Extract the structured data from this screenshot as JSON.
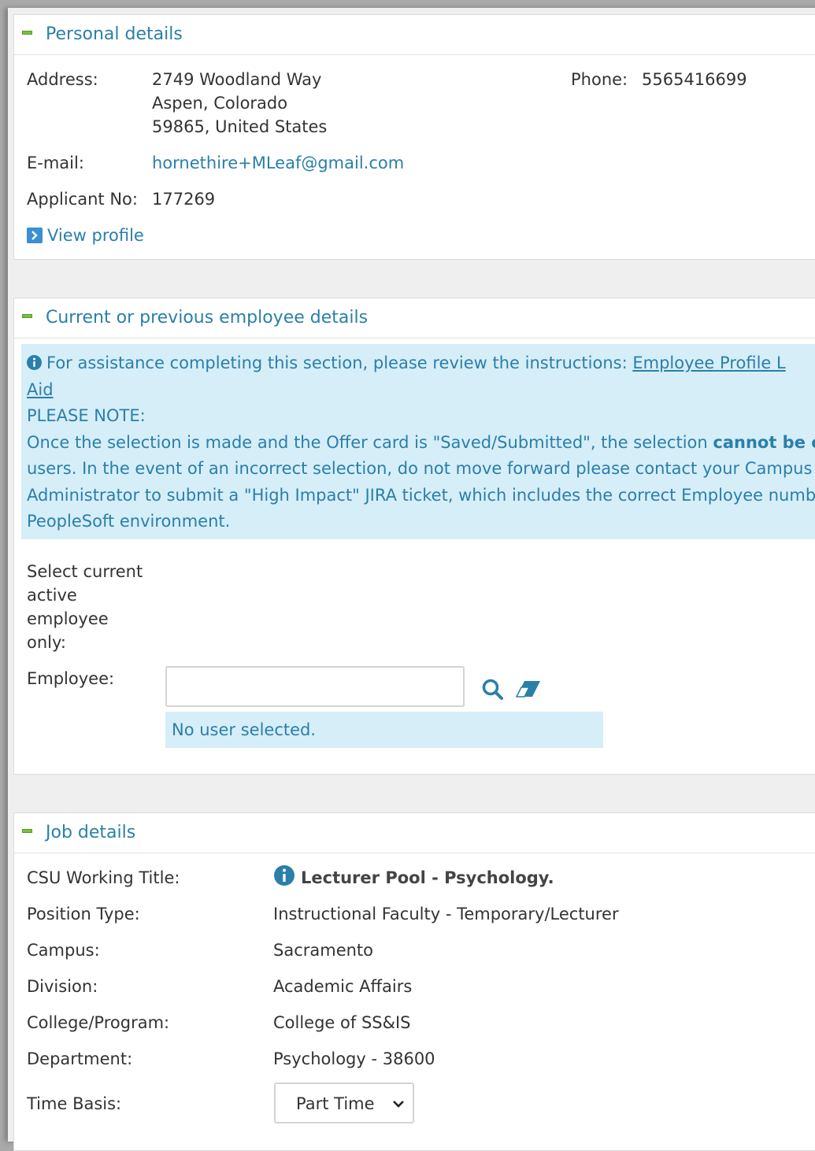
{
  "personal": {
    "title": "Personal details",
    "address_label": "Address:",
    "address_line1": "2749 Woodland Way",
    "address_line2": "Aspen, Colorado",
    "address_line3": "59865, United States",
    "phone_label": "Phone:",
    "phone_value": "5565416699",
    "email_label": "E-mail:",
    "email_value": "hornethire+MLeaf@gmail.com",
    "applicant_label": "Applicant No:",
    "applicant_value": "177269",
    "view_profile": "View profile"
  },
  "employee": {
    "title": "Current or previous employee details",
    "info_line1_text": "For assistance completing this section, please review the instructions: ",
    "info_link_part1": "Employee Profile L",
    "info_link_part2": "Aid",
    "note_heading": "PLEASE NOTE:",
    "note_line1_a": "Once the selection is made and the Offer card is \"Saved/Submitted\", the selection ",
    "note_line1_b": "cannot be e",
    "note_line2": "users. In the event of an incorrect selection, do not move forward please contact your Campus",
    "note_line3": "Administrator to submit a \"High Impact\" JIRA ticket, which includes the correct Employee numb",
    "note_line4": "PeopleSoft environment.",
    "select_line1": "Select current",
    "select_line2": "active",
    "select_line3": "employee",
    "select_line4": "only:",
    "employee_label": "Employee:",
    "employee_value": "",
    "no_user": "No user selected."
  },
  "job": {
    "title": "Job details",
    "rows": [
      {
        "label": "CSU Working Title:",
        "value": "Lecturer Pool - Psychology."
      },
      {
        "label": "Position Type:",
        "value": "Instructional Faculty - Temporary/Lecturer"
      },
      {
        "label": "Campus:",
        "value": "Sacramento"
      },
      {
        "label": "Division:",
        "value": "Academic Affairs"
      },
      {
        "label": "College/Program:",
        "value": "College of SS&IS"
      },
      {
        "label": "Department:",
        "value": "Psychology - 38600"
      }
    ],
    "time_basis_label": "Time Basis:",
    "time_basis_value": "Part Time"
  },
  "colors": {
    "accent": "#2a7fa9",
    "info_bg": "#d6eef8",
    "collapse_green": "#7bbf3c"
  },
  "icons": [
    "collapse-icon",
    "chevron-right-icon",
    "info-icon",
    "search-icon",
    "eraser-icon",
    "chevron-down-icon"
  ]
}
